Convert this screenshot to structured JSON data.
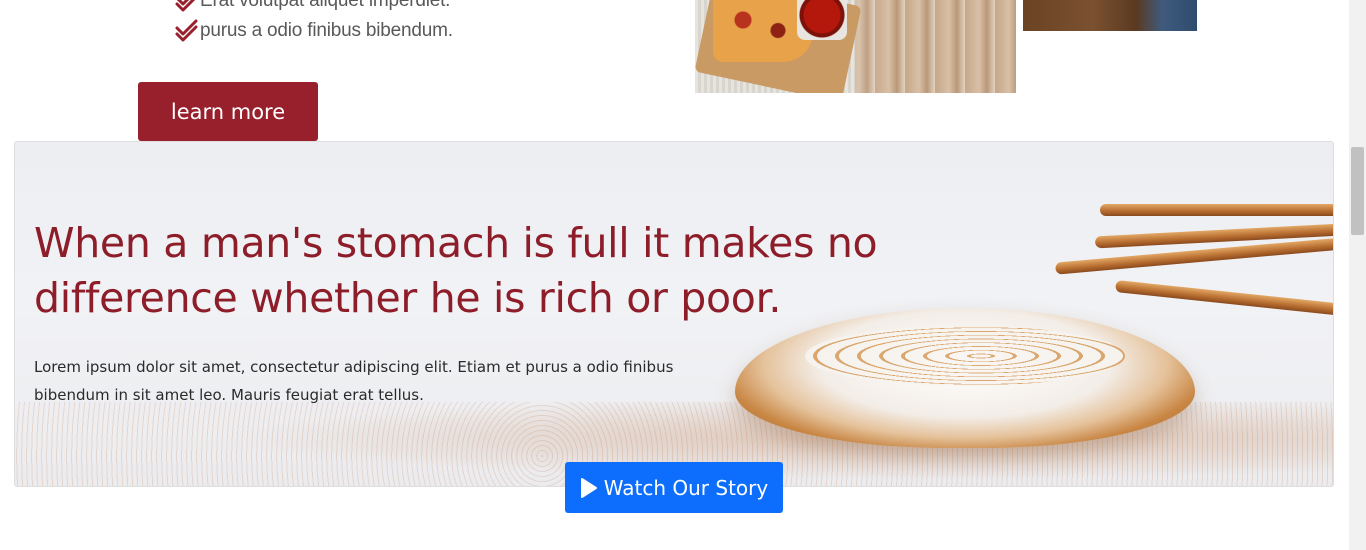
{
  "features": {
    "items": [
      "Erat volutpat aliquet imperdiet.",
      "purus a odio finibus bibendum."
    ],
    "icon": "double-check-icon"
  },
  "cta": {
    "learn_more_label": "learn more"
  },
  "hero": {
    "title": "When a man's stomach is full it makes no difference whether he is rich or poor.",
    "text": "Lorem ipsum dolor sit amet, consectetur adipiscing elit. Etiam et purus a odio finibus bibendum in sit amet leo. Mauris feugiat erat tellus.",
    "watch_label": "Watch Our Story",
    "watch_icon": "play-icon"
  },
  "colors": {
    "accent": "#98202d",
    "title": "#8e1d2a",
    "primary_button": "#0d6efd"
  }
}
